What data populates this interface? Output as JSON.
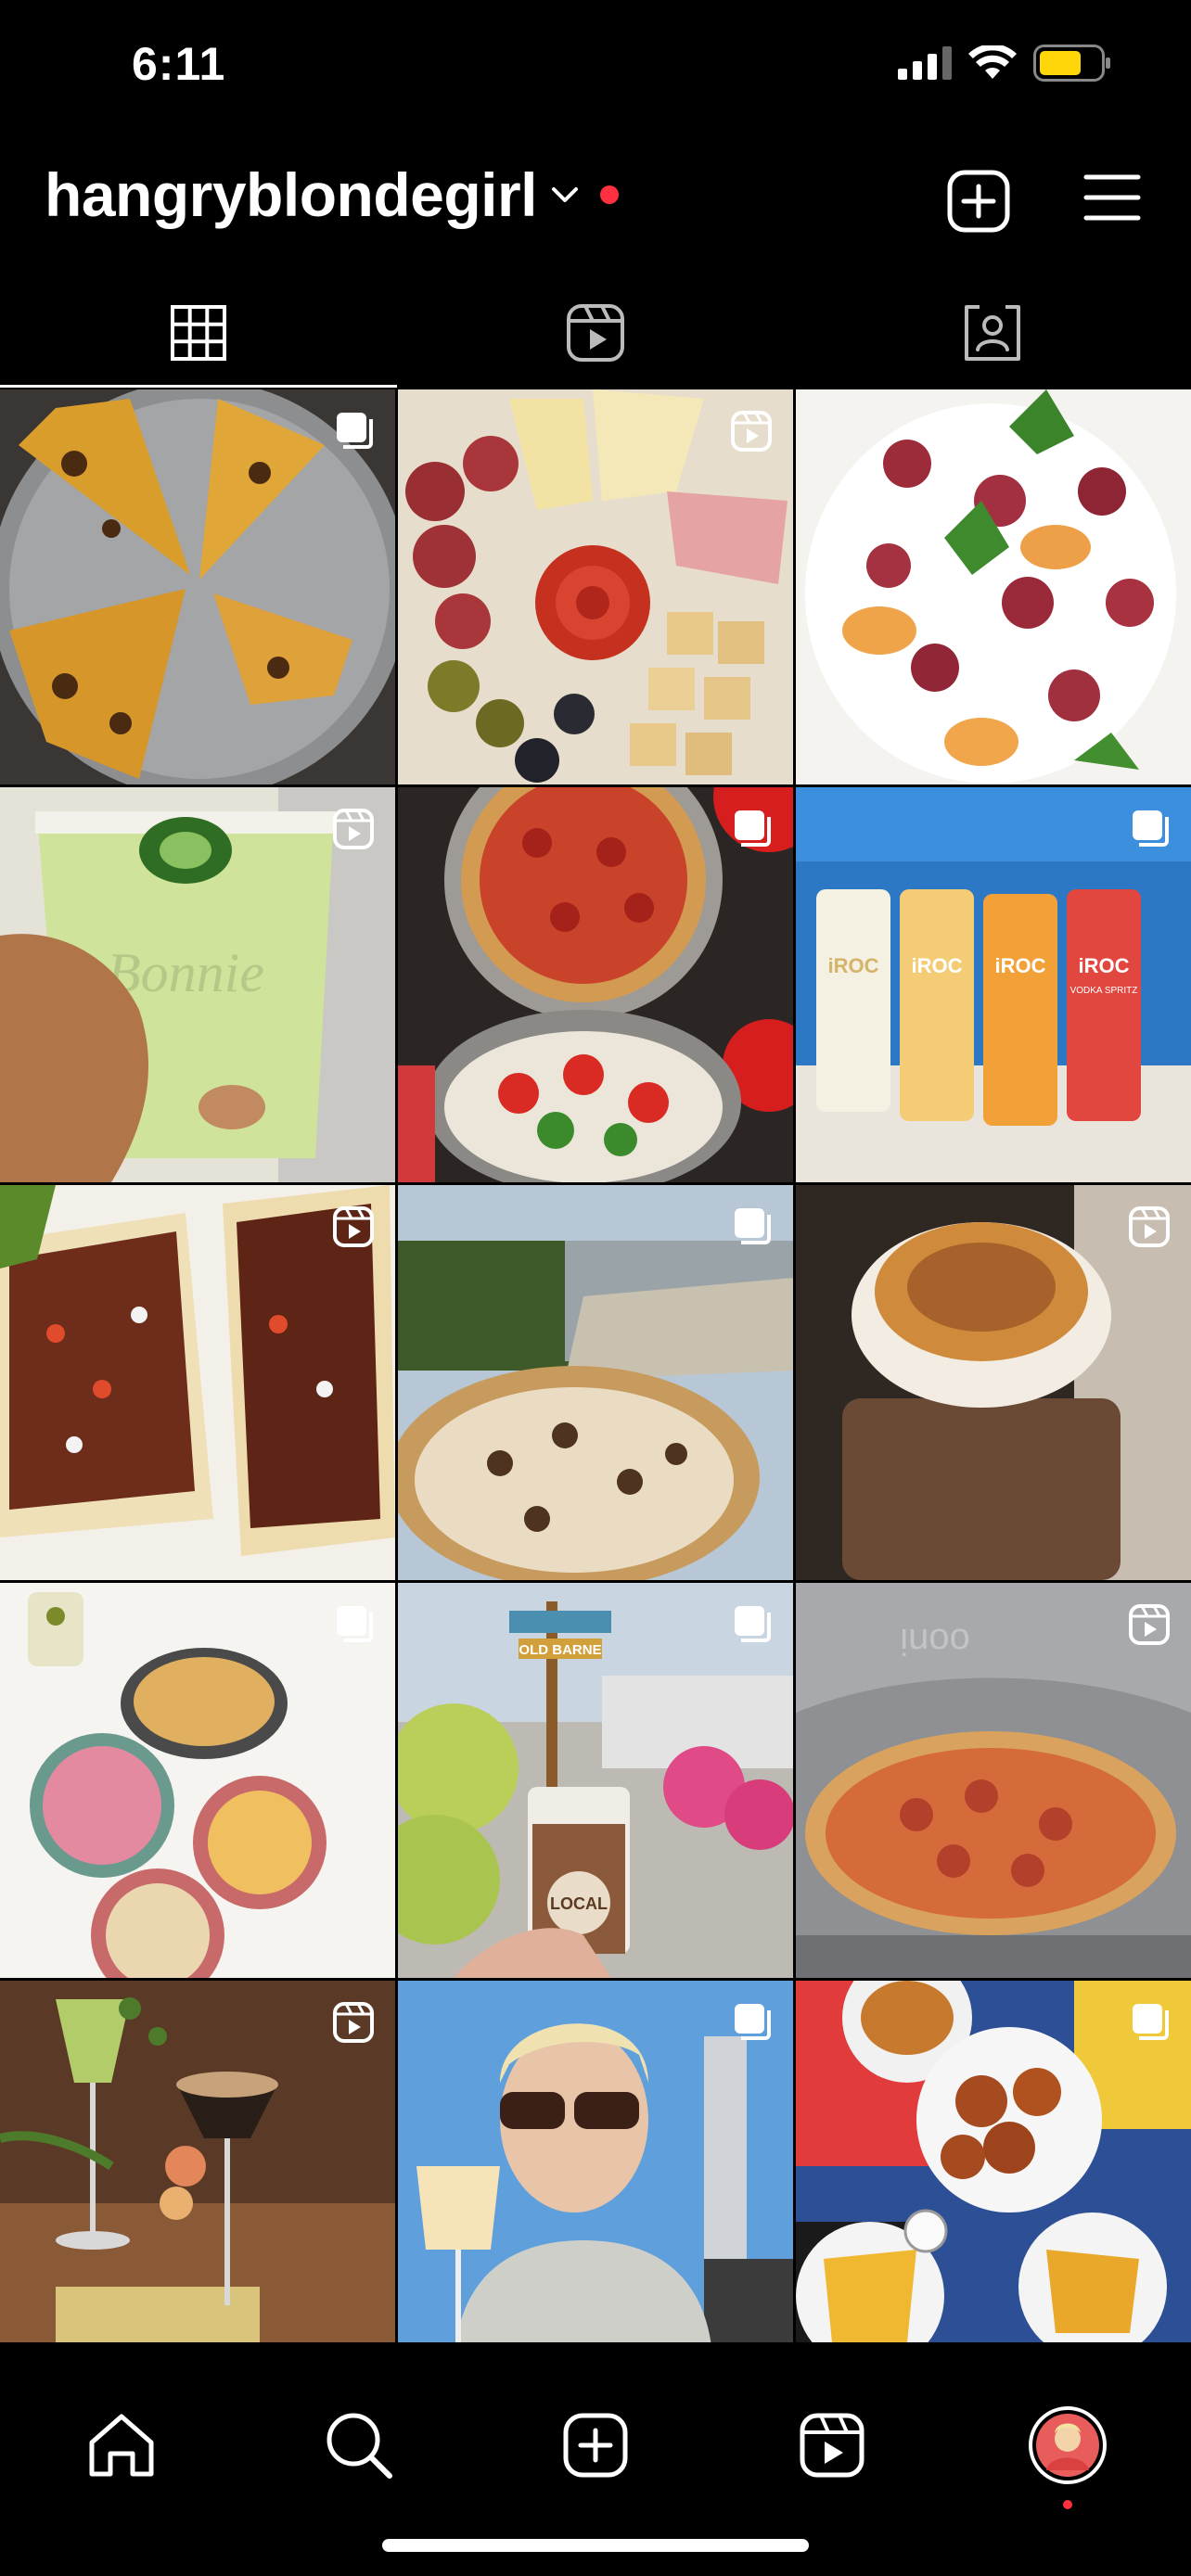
{
  "status_bar": {
    "time": "6:11"
  },
  "header": {
    "username": "hangryblondegirl"
  },
  "tabs": [
    {
      "id": "posts",
      "icon": "grid-icon",
      "active": true
    },
    {
      "id": "reels",
      "icon": "reels-icon",
      "active": false
    },
    {
      "id": "tagged",
      "icon": "tagged-person-icon",
      "active": false
    }
  ],
  "posts": [
    {
      "subject": "sliced pizza",
      "type": "carousel"
    },
    {
      "subject": "charcuterie board",
      "type": "reel"
    },
    {
      "subject": "fig burrata salad",
      "type": "photo"
    },
    {
      "subject": "jalapeño margarita",
      "type": "reel"
    },
    {
      "subject": "pizza and caprese salad",
      "type": "carousel"
    },
    {
      "subject": "iROC spritz cans",
      "type": "carousel"
    },
    {
      "subject": "burrito",
      "type": "reel"
    },
    {
      "subject": "pizza by the water",
      "type": "carousel"
    },
    {
      "subject": "toasted marshmallow drink",
      "type": "reel"
    },
    {
      "subject": "mezze plates",
      "type": "carousel"
    },
    {
      "subject": "iced coffee cup",
      "type": "carousel"
    },
    {
      "subject": "ooni pizza oven",
      "type": "reel"
    },
    {
      "subject": "cocktails with flowers",
      "type": "reel"
    },
    {
      "subject": "person drinking wine",
      "type": "carousel"
    },
    {
      "subject": "wings and fries",
      "type": "carousel"
    }
  ],
  "tile_text": {
    "glass_brand": "Bonnie",
    "can_brand": "iROC",
    "can_sub": "VODKA SPRITZ",
    "sign_text": "OLD BARNE",
    "cup_text": "LOCAL",
    "oven_brand": "ooni"
  },
  "bottom_nav": [
    "home-icon",
    "search-icon",
    "create-icon",
    "reels-icon",
    "profile-avatar"
  ],
  "colors": {
    "accent_dot": "#ff3040",
    "battery": "#ffd60a",
    "background": "#000000"
  }
}
